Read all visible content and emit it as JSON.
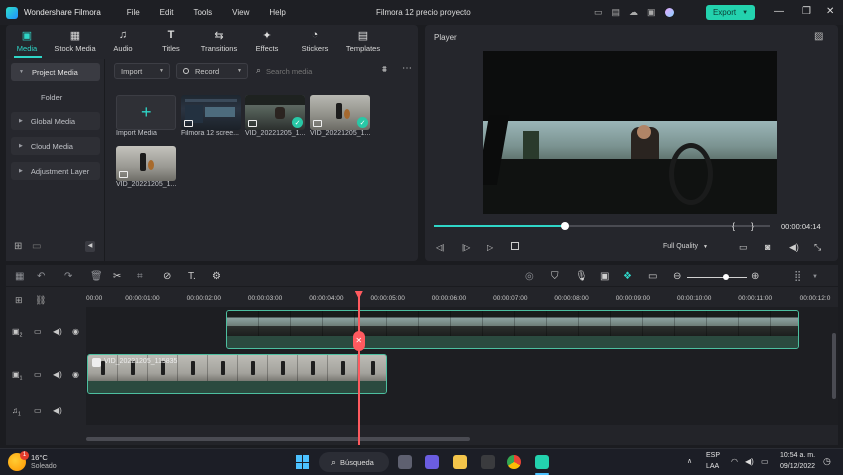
{
  "app": {
    "name": "Wondershare Filmora",
    "project_title": "Filmora 12 precio proyecto",
    "export_label": "Export"
  },
  "menu": [
    "File",
    "Edit",
    "Tools",
    "View",
    "Help"
  ],
  "media_tabs": [
    {
      "label": "Media",
      "icon": "media-icon",
      "active": true
    },
    {
      "label": "Stock Media",
      "icon": "stock-media-icon"
    },
    {
      "label": "Audio",
      "icon": "music-note-icon"
    },
    {
      "label": "Titles",
      "icon": "text-t-icon"
    },
    {
      "label": "Transitions",
      "icon": "transitions-icon"
    },
    {
      "label": "Effects",
      "icon": "effects-icon"
    },
    {
      "label": "Stickers",
      "icon": "stickers-icon"
    },
    {
      "label": "Templates",
      "icon": "templates-icon"
    }
  ],
  "sidebar": {
    "project_media": "Project Media",
    "folder": "Folder",
    "global_media": "Global Media",
    "cloud_media": "Cloud Media",
    "adjustment_layer": "Adjustment Layer"
  },
  "media_toolbar": {
    "import_label": "Import",
    "record_label": "Record",
    "search_placeholder": "Search media"
  },
  "media_items": [
    {
      "label": "Import Media",
      "type": "import"
    },
    {
      "label": "Filmora 12 scree...",
      "type": "screen"
    },
    {
      "label": "VID_20221205_1...",
      "type": "video",
      "checked": true
    },
    {
      "label": "VID_20221205_1...",
      "type": "guitar",
      "checked": true
    },
    {
      "label": "VID_20221205_1...",
      "type": "guitar"
    }
  ],
  "player": {
    "label": "Player",
    "timecode": "00:00:04:14",
    "quality": "Full Quality",
    "progress": 0.39,
    "brace_open": "{",
    "brace_close": "}"
  },
  "timeline": {
    "ruler_ticks": [
      "00:00",
      "00:00:01:00",
      "00:00:02:00",
      "00:00:03:00",
      "00:00:04:00",
      "00:00:05:00",
      "00:00:06:00",
      "00:00:07:00",
      "00:00:08:00",
      "00:00:09:00",
      "00:00:10:00",
      "00:00:11:00",
      "00:00:12:0"
    ],
    "tracks": [
      {
        "index": "2",
        "type": "video"
      },
      {
        "index": "1",
        "type": "video"
      },
      {
        "index": "1",
        "type": "audio"
      }
    ],
    "clip_label": "VID_20221205_115835",
    "playhead_time_seconds": 4.45
  },
  "taskbar": {
    "weather_temp": "16°C",
    "weather_desc": "Soleado",
    "weather_badge": "1",
    "search_label": "Búsqueda",
    "lang_top": "ESP",
    "lang_bottom": "LAA",
    "time": "10:54 a. m.",
    "date": "09/12/2022"
  },
  "colors": {
    "accent": "#23d2ae",
    "playhead": "#ff5a5f",
    "background": "#1b1c20"
  }
}
